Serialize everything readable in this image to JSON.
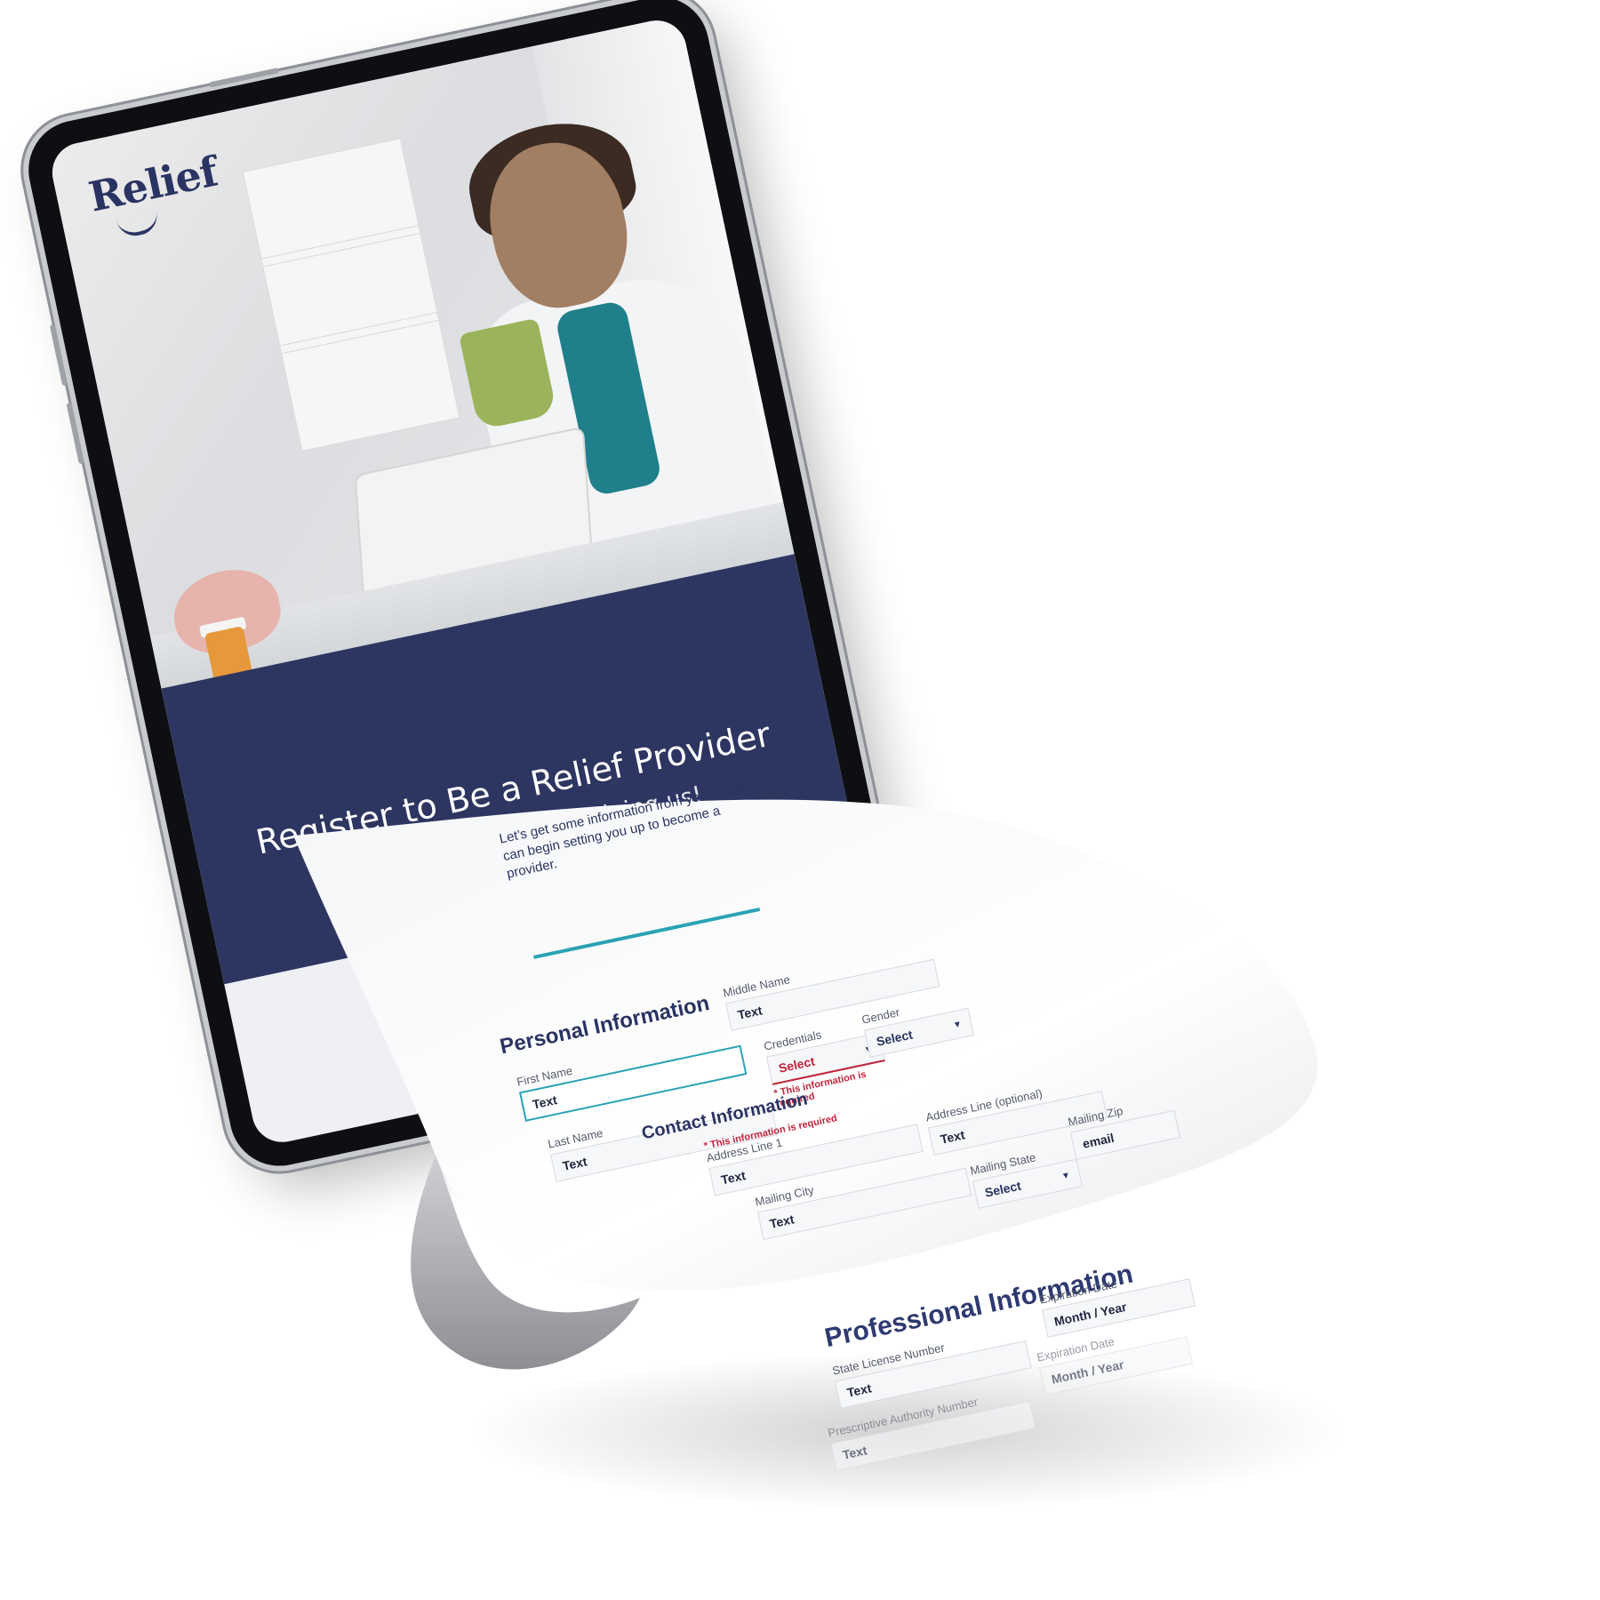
{
  "brand": {
    "logo_text": "Relief",
    "primary_color": "#2d3561",
    "accent_color": "#2aa3b4",
    "error_color": "#c0243a"
  },
  "hero": {
    "title": "Register to Be a Relief Provider",
    "subtitle": "We’re excited you’re joining us!"
  },
  "intro": {
    "text": "Let’s get some information from you so we can begin setting you up to become a provider."
  },
  "personal": {
    "title": "Personal Information",
    "first_name": {
      "label": "First Name",
      "value": "Text"
    },
    "middle_name": {
      "label": "Middle Name",
      "value": "Text"
    },
    "last_name": {
      "label": "Last Name",
      "value": "Text"
    },
    "credentials": {
      "label": "Credentials",
      "value": "Select",
      "error": "* This information is required"
    },
    "gender": {
      "label": "Gender",
      "value": "Select"
    }
  },
  "contact": {
    "title": "Contact Information",
    "address_line_1": {
      "label": "Address Line 1",
      "value": "Text",
      "error": "* This information is required"
    },
    "address_line_2": {
      "label": "Address Line (optional)",
      "value": "Text"
    },
    "mailing_city": {
      "label": "Mailing City",
      "value": "Text"
    },
    "mailing_state": {
      "label": "Mailing State",
      "value": "Select"
    },
    "mailing_zip": {
      "label": "Mailing Zip",
      "value": "email"
    }
  },
  "professional": {
    "title": "Professional Information",
    "state_license": {
      "label": "State License Number",
      "value": "Text"
    },
    "expiration_date_1": {
      "label": "Expiration Date",
      "value": "Month / Year"
    },
    "prescriptive_authority": {
      "label": "Prescriptive Authority Number",
      "value": "Text"
    },
    "expiration_date_2": {
      "label": "Expiration Date",
      "value": "Month / Year"
    }
  },
  "icons": {
    "caret": "▼"
  }
}
